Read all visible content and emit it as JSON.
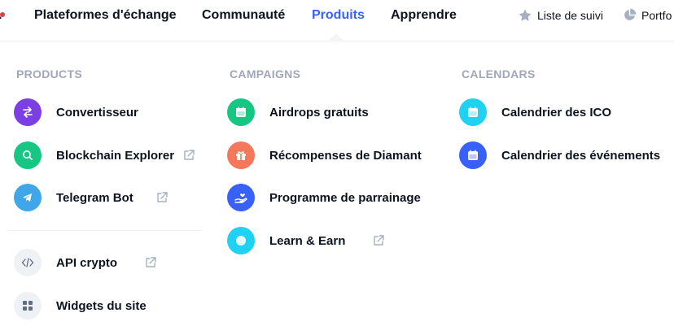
{
  "nav": {
    "items": [
      {
        "label": "Plateformes d'échange"
      },
      {
        "label": "Communauté"
      },
      {
        "label": "Produits"
      },
      {
        "label": "Apprendre"
      }
    ],
    "watchlist": "Liste de suivi",
    "portfolio": "Portfo"
  },
  "products": {
    "title": "PRODUCTS",
    "items": [
      {
        "label": "Convertisseur",
        "icon": "swap-icon",
        "color": "#7b3fe4"
      },
      {
        "label": "Blockchain Explorer",
        "icon": "search-icon",
        "color": "#16c784"
      },
      {
        "label": "Telegram Bot",
        "icon": "telegram-icon",
        "color": "#3ea6e9"
      },
      {
        "label": "API crypto",
        "icon": "code-icon",
        "color": "#eff2f5"
      },
      {
        "label": "Widgets du site",
        "icon": "grid-icon",
        "color": "#eff2f5"
      }
    ]
  },
  "campaigns": {
    "title": "CAMPAIGNS",
    "items": [
      {
        "label": "Airdrops gratuits",
        "icon": "calendar-icon",
        "color": "#16c784"
      },
      {
        "label": "Récompenses de Diamant",
        "icon": "gift-icon",
        "color": "#f5775c"
      },
      {
        "label": "Programme de parrainage",
        "icon": "hand-heart-icon",
        "color": "#3861fb"
      },
      {
        "label": "Learn & Earn",
        "icon": "circle-icon",
        "color": "#1fd2f2"
      }
    ]
  },
  "calendars": {
    "title": "CALENDARS",
    "items": [
      {
        "label": "Calendrier des ICO",
        "icon": "calendar-icon",
        "color": "#1fd2f2"
      },
      {
        "label": "Calendrier des événements",
        "icon": "calendar-icon",
        "color": "#3861fb"
      }
    ]
  }
}
